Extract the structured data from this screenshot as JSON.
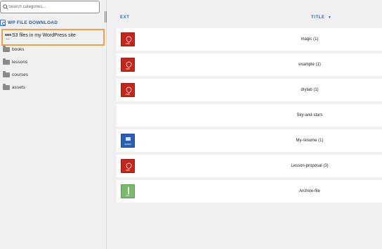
{
  "search": {
    "placeholder": "Search categories..."
  },
  "sidebar": {
    "plugin_title": "WP FILE DOWNLOAD",
    "s3_item": {
      "badge": "aws",
      "label": "S3 files in my WordPress site"
    },
    "categories": [
      "books",
      "lessons",
      "courses",
      "assets"
    ]
  },
  "table": {
    "headers": {
      "ext": "EXT",
      "title": "TITLE",
      "sort_icon": "▼"
    },
    "rows": [
      {
        "icon": "pdf",
        "title": "magic (1)"
      },
      {
        "icon": "pdf",
        "title": "example (1)"
      },
      {
        "icon": "pdf",
        "title": "drylab (1)"
      },
      {
        "icon": "none",
        "title": "Sky-and-stars"
      },
      {
        "icon": "doc",
        "title": "My-resume (1)"
      },
      {
        "icon": "pdf",
        "title": "Lesson-proposal (3)"
      },
      {
        "icon": "zip",
        "title": "Archive-file"
      }
    ]
  },
  "colors": {
    "accent": "#2b6cb8",
    "highlight_border": "#f0a04b",
    "pdf": "#c2271e",
    "doc": "#2b5fb4",
    "zip": "#7cb870"
  }
}
